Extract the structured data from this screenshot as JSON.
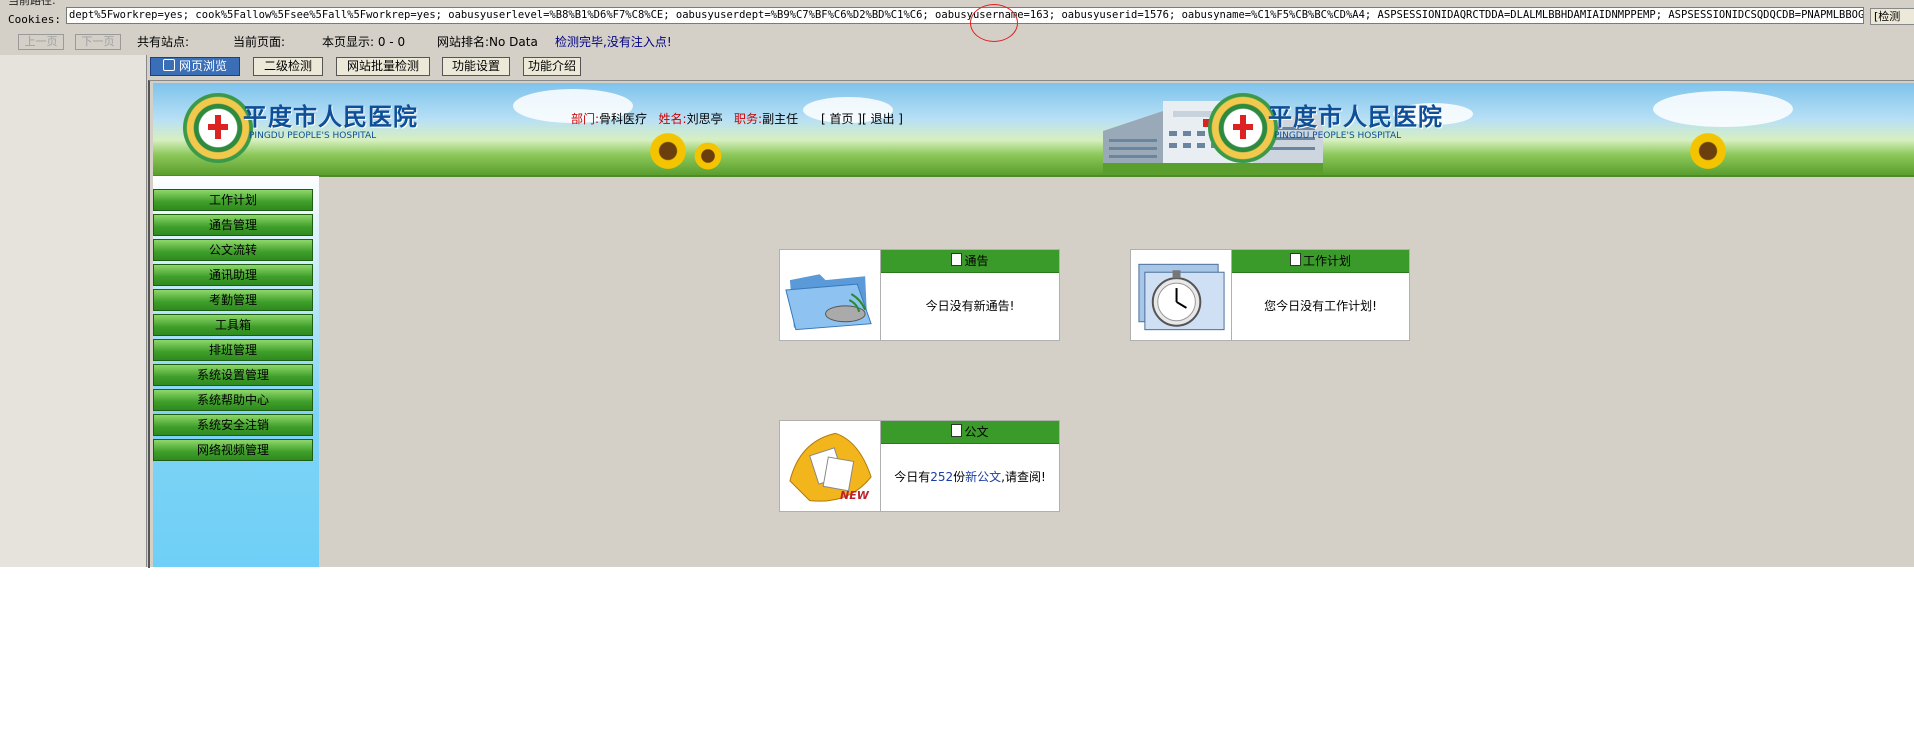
{
  "tool": {
    "cut_label": "当前路径:",
    "cookies_label": "Cookies:",
    "cookies_value": "dept%5Fworkrep=yes; cook%5Fallow%5Fsee%5Fall%5Fworkrep=yes; oabusyuserlevel=%B8%B1%D6%F7%C8%CE; oabusyuserdept=%B9%C7%BF%C6%D2%BD%C1%C6; oabusyusername=163; oabusyuserid=1576; oabusyname=%C1%F5%CB%BC%CD%A4; ASPSESSIONIDAQRCTDDA=DLALMLBBHDAMIAIDNMPPEMP; ASPSESSIONIDCSQDQCDB=PNAPMLBBOGHOAJLJDGIAKNF",
    "edge_button": "[检测",
    "prev_button": "上一页",
    "next_button": "下一页",
    "status": {
      "sites": "共有站点:",
      "page": "当前页面:",
      "show": "本页显示: 0 - 0",
      "rank": "网站排名:No Data",
      "done": "检测完毕,没有注入点!"
    },
    "tabs": {
      "browse": "网页浏览",
      "level2": "二级检测",
      "batch": "网站批量检测",
      "settings": "功能设置",
      "intro": "功能介绍"
    }
  },
  "banner": {
    "hospital_cn": "平度市人民医院",
    "hospital_en": "PINGDU PEOPLE'S HOSPITAL"
  },
  "user_info": {
    "dept_label": "部门:",
    "dept": "骨科医疗",
    "name_label": "姓名:",
    "name": "刘思亭",
    "title_label": "职务:",
    "title": "副主任",
    "home": "[ 首页 ]",
    "logout": "[ 退出 ]"
  },
  "menu": [
    "工作计划",
    "通告管理",
    "公文流转",
    "通讯助理",
    "考勤管理",
    "工具箱",
    "排班管理",
    "系统设置管理",
    "系统帮助中心",
    "系统安全注销",
    "网络视频管理"
  ],
  "cards": {
    "notice": {
      "title": "通告",
      "body": "今日没有新通告!"
    },
    "plan": {
      "title": "工作计划",
      "body": "您今日没有工作计划!"
    },
    "doc": {
      "title": "公文",
      "body_pre": "今日有",
      "count": "252",
      "body_mid": "份",
      "link": "新公文",
      "body_post": ",请查阅!",
      "new_tag": "NEW"
    }
  }
}
